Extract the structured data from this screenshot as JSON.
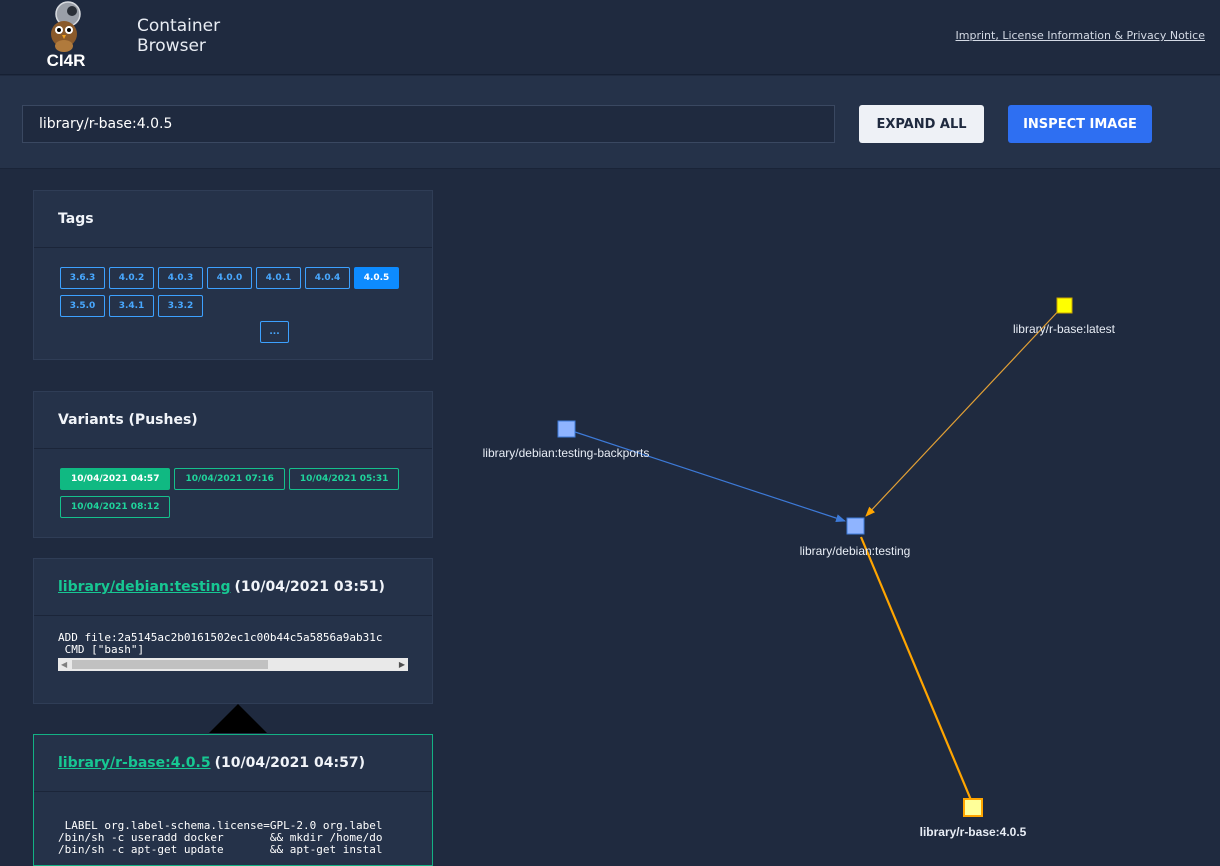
{
  "header": {
    "logo_text": "CI4R",
    "app_title_line1": "Container",
    "app_title_line2": "Browser",
    "imprint_link": "Imprint, License Information & Privacy Notice"
  },
  "search": {
    "value": "library/r-base:4.0.5",
    "expand_all_label": "EXPAND ALL",
    "inspect_label": "INSPECT IMAGE"
  },
  "tags_panel": {
    "title": "Tags",
    "tags": [
      "3.6.3",
      "4.0.2",
      "4.0.3",
      "4.0.0",
      "4.0.1",
      "4.0.4",
      "4.0.5",
      "3.5.0",
      "3.4.1",
      "3.3.2",
      "..."
    ],
    "selected": "4.0.5"
  },
  "variants_panel": {
    "title": "Variants (Pushes)",
    "variants": [
      "10/04/2021 04:57",
      "10/04/2021 07:16",
      "10/04/2021 05:31",
      "10/04/2021 08:12"
    ],
    "selected": "10/04/2021 04:57"
  },
  "layer_debian": {
    "link": "library/debian:testing",
    "date": "(10/04/2021 03:51)",
    "code_line1": "ADD file:2a5145ac2b0161502ec1c00b44c5a5856a9ab31c",
    "code_line2": " CMD [\"bash\"]"
  },
  "layer_rbase": {
    "link": "library/r-base:4.0.5",
    "date": "(10/04/2021 04:57)",
    "code_line1": " LABEL org.label-schema.license=GPL-2.0 org.label",
    "code_line2": "/bin/sh -c useradd docker       && mkdir /home/do",
    "code_line3": "/bin/sh -c apt-get update       && apt-get instal"
  },
  "graph": {
    "nodes": {
      "latest": "library/r-base:latest",
      "backports": "library/debian:testing-backports",
      "testing": "library/debian:testing",
      "rbase405": "library/r-base:4.0.5"
    },
    "colors": {
      "blue_node": "#8fb4ff",
      "yellow_node": "#ffff00",
      "edge_blue": "#3d7ad8",
      "edge_orange": "#ffa500"
    }
  }
}
